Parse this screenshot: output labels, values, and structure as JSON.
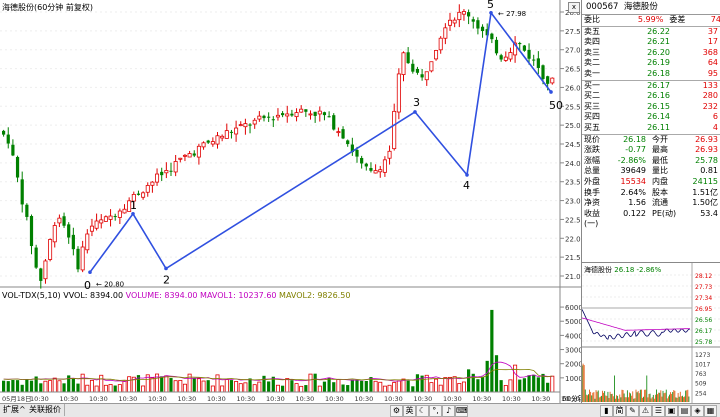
{
  "title": {
    "main": "海德股份(60分钟 前复权)",
    "mini_ticker": "海德股份",
    "mini_price": "26.18",
    "mini_change": "-2.86%"
  },
  "volume_panel": {
    "indicator": "VOL-TDX(5,10)",
    "vvol": "VVOL: 8394.00",
    "volume": "VOLUME: 8394.00",
    "mavol1": "MAVOL1: 10237.60",
    "mavol2": "MAVOL2: 9826.50"
  },
  "quote": {
    "code": "000567",
    "name": "海德股份",
    "weibi_label": "委比",
    "weibi_value": "5.99%",
    "weicha_label": "委差",
    "weicha_value": "74",
    "asks": [
      {
        "label": "卖五",
        "price": "26.22",
        "vol": "37"
      },
      {
        "label": "卖四",
        "price": "26.21",
        "vol": "17"
      },
      {
        "label": "卖三",
        "price": "26.20",
        "vol": "368"
      },
      {
        "label": "卖二",
        "price": "26.19",
        "vol": "64"
      },
      {
        "label": "卖一",
        "price": "26.18",
        "vol": "95"
      }
    ],
    "bids": [
      {
        "label": "买一",
        "price": "26.17",
        "vol": "133"
      },
      {
        "label": "买二",
        "price": "26.16",
        "vol": "280"
      },
      {
        "label": "买三",
        "price": "26.15",
        "vol": "232"
      },
      {
        "label": "买四",
        "price": "26.14",
        "vol": "6"
      },
      {
        "label": "买五",
        "price": "26.11",
        "vol": "4"
      }
    ],
    "stats": [
      {
        "l1": "现价",
        "v1": "26.18",
        "c1": "green",
        "l2": "今开",
        "v2": "26.93",
        "c2": "red"
      },
      {
        "l1": "涨跌",
        "v1": "-0.77",
        "c1": "green",
        "l2": "最高",
        "v2": "26.93",
        "c2": "red"
      },
      {
        "l1": "涨幅",
        "v1": "-2.86%",
        "c1": "green",
        "l2": "最低",
        "v2": "25.78",
        "c2": "green"
      },
      {
        "l1": "总量",
        "v1": "39649",
        "c1": "black",
        "l2": "量比",
        "v2": "0.81",
        "c2": "black"
      },
      {
        "l1": "外盘",
        "v1": "15534",
        "c1": "red",
        "l2": "内盘",
        "v2": "24115",
        "c2": "green"
      },
      {
        "l1": "换手",
        "v1": "2.64%",
        "c1": "black",
        "l2": "股本",
        "v2": "1.51亿",
        "c2": "black"
      },
      {
        "l1": "净资",
        "v1": "1.56",
        "c1": "black",
        "l2": "流通",
        "v2": "1.50亿",
        "c2": "black"
      },
      {
        "l1": "收益(一)",
        "v1": "0.122",
        "c1": "black",
        "l2": "PE(动)",
        "v2": "53.4",
        "c2": "black"
      }
    ]
  },
  "price_axis": [
    "28.00",
    "27.50",
    "27.00",
    "26.50",
    "26.00",
    "25.50",
    "25.00",
    "24.50",
    "24.00",
    "23.50",
    "23.00",
    "22.50",
    "22.00",
    "21.50",
    "21.00"
  ],
  "volume_axis": [
    "60000",
    "50000",
    "40000",
    "30000",
    "20000",
    "10000"
  ],
  "mini_price_axis": [
    "28.12",
    "27.73",
    "27.34",
    "26.95",
    "26.56",
    "26.17",
    "25.78"
  ],
  "mini_price_axis_right": [
    "7.41%",
    "5.92%",
    "4.43%",
    "2.95%",
    "1.46%",
    "0.00%",
    "1.46%",
    "2.95%",
    "4.43%",
    "5.92%",
    "7.41%"
  ],
  "mini_vol_axis": [
    "1273",
    "1017",
    "763",
    "509",
    "254"
  ],
  "mini_changes": [
    "7.41%",
    "5.92%",
    "4.43%",
    "2.95%",
    "1.46%",
    "0.00%",
    "1.46%",
    "2.95%",
    "4.43%"
  ],
  "mini_changes_shown": [
    "2.95%",
    "1.46%",
    "0.00%",
    "1.46%",
    "2.95%",
    "4.43%",
    "5.92%",
    "7.41%"
  ],
  "time_labels": [
    "05月18日",
    "10:30",
    "10:30",
    "10:30",
    "10:30",
    "10:30",
    "10:30",
    "10:30",
    "10:30",
    "10:30",
    "10:30",
    "10:30",
    "10:30",
    "10:30",
    "10:30",
    "10:30",
    "10:30",
    "10:30",
    "10:30",
    "10:30"
  ],
  "wave_labels": [
    "0",
    "1",
    "2",
    "3",
    "4",
    "5",
    "50"
  ],
  "annotations": {
    "low": "20.80",
    "high": "27.98"
  },
  "bottombar": {
    "tab1": "扩展^",
    "tab2": "关联报价",
    "period": "60分钟",
    "icon1": "英",
    "icon2": "♪",
    "icon3": "简"
  }
}
